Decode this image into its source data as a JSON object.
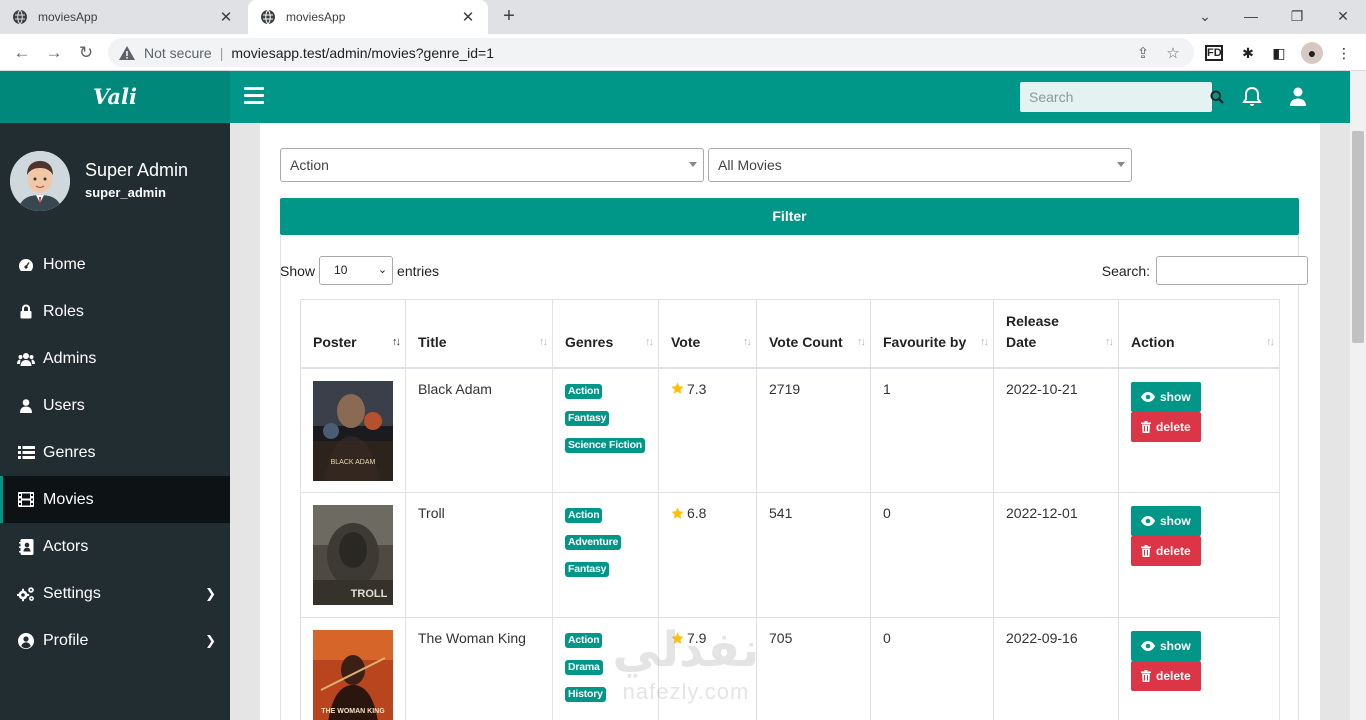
{
  "browser": {
    "tabs": [
      {
        "title": "moviesApp",
        "active": false
      },
      {
        "title": "moviesApp",
        "active": true
      }
    ],
    "security_label": "Not secure",
    "url": "moviesapp.test/admin/movies?genre_id=1"
  },
  "header": {
    "brand": "Vali",
    "search_placeholder": "Search"
  },
  "sidebar": {
    "user": {
      "name": "Super Admin",
      "role": "super_admin"
    },
    "items": [
      {
        "label": "Home",
        "icon": "dashboard-icon"
      },
      {
        "label": "Roles",
        "icon": "lock-icon"
      },
      {
        "label": "Admins",
        "icon": "users-icon"
      },
      {
        "label": "Users",
        "icon": "user-icon"
      },
      {
        "label": "Genres",
        "icon": "list-icon"
      },
      {
        "label": "Movies",
        "icon": "film-icon",
        "active": true
      },
      {
        "label": "Actors",
        "icon": "address-book-icon"
      },
      {
        "label": "Settings",
        "icon": "cogs-icon",
        "has_submenu": true
      },
      {
        "label": "Profile",
        "icon": "user-circle-icon",
        "has_submenu": true
      }
    ]
  },
  "filters": {
    "genre_value": "Action",
    "type_value": "All Movies",
    "filter_label": "Filter"
  },
  "datatable": {
    "show_label": "Show",
    "entries_value": "10",
    "entries_label": "entries",
    "search_label": "Search:",
    "columns": [
      "Poster",
      "Title",
      "Genres",
      "Vote",
      "Vote Count",
      "Favourite by",
      "Release Date",
      "Action"
    ],
    "show_label_btn": "show",
    "delete_label_btn": "delete",
    "rows": [
      {
        "title": "Black Adam",
        "genres": [
          "Action",
          "Fantasy",
          "Science Fiction"
        ],
        "vote": "7.3",
        "vote_count": "2719",
        "favourite_by": "1",
        "release_date": "2022-10-21",
        "poster_text": "BLACK ADAM"
      },
      {
        "title": "Troll",
        "genres": [
          "Action",
          "Adventure",
          "Fantasy"
        ],
        "vote": "6.8",
        "vote_count": "541",
        "favourite_by": "0",
        "release_date": "2022-12-01",
        "poster_text": "TROLL"
      },
      {
        "title": "The Woman King",
        "genres": [
          "Action",
          "Drama",
          "History"
        ],
        "vote": "7.9",
        "vote_count": "705",
        "favourite_by": "0",
        "release_date": "2022-09-16",
        "poster_text": "THE WOMAN KING"
      }
    ]
  },
  "watermark": {
    "arabic": "نفذلي",
    "latin": "nafezly.com"
  },
  "colors": {
    "primary": "#009688",
    "danger": "#dc3545",
    "sidebar": "#222d32"
  }
}
